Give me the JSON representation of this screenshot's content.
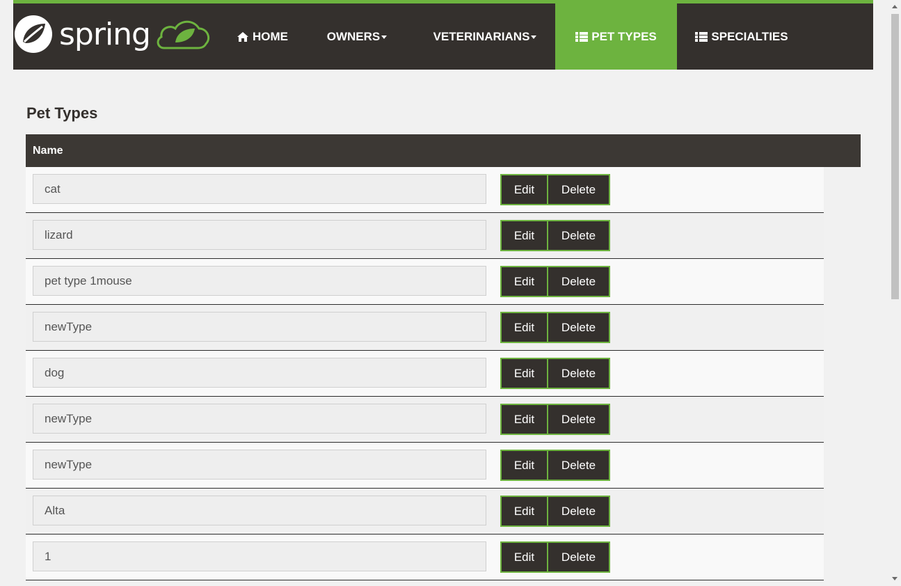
{
  "brand": {
    "name": "spring"
  },
  "nav": {
    "items": [
      {
        "label": "HOME",
        "icon": "home-icon",
        "dropdown": false,
        "active": false
      },
      {
        "label": "OWNERS",
        "icon": "",
        "dropdown": true,
        "active": false
      },
      {
        "label": "VETERINARIANS",
        "icon": "",
        "dropdown": true,
        "active": false
      },
      {
        "label": "PET TYPES",
        "icon": "list-icon",
        "dropdown": false,
        "active": true
      },
      {
        "label": "SPECIALTIES",
        "icon": "list-icon",
        "dropdown": false,
        "active": false
      }
    ]
  },
  "page": {
    "title": "Pet Types"
  },
  "table": {
    "header": "Name",
    "rows": [
      {
        "name": "cat"
      },
      {
        "name": "lizard"
      },
      {
        "name": "pet type 1mouse"
      },
      {
        "name": "newType"
      },
      {
        "name": "dog"
      },
      {
        "name": "newType"
      },
      {
        "name": "newType"
      },
      {
        "name": "Alta"
      },
      {
        "name": "1"
      }
    ],
    "edit_label": "Edit",
    "delete_label": "Delete"
  },
  "colors": {
    "accent": "#6db33f",
    "dark": "#34302d",
    "background": "#f1f1f1"
  }
}
